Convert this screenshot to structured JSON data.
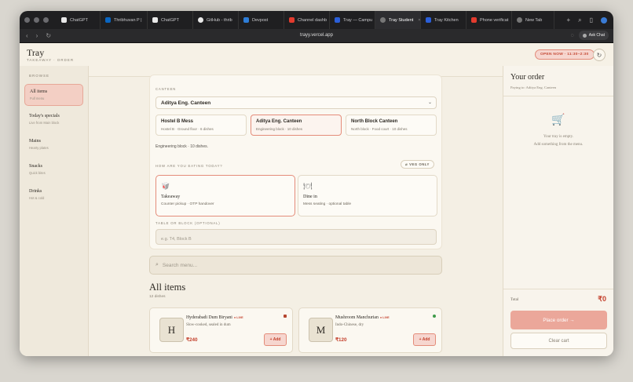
{
  "browser": {
    "tabs": [
      {
        "label": "ChatGPT",
        "favicon_color": "#e9e9e9"
      },
      {
        "label": "Thribhuvan P |",
        "favicon_color": "#0a66c2"
      },
      {
        "label": "ChatGPT",
        "favicon_color": "#e9e9e9"
      },
      {
        "label": "GitHub - thrib",
        "favicon_color": "#e9e9e9"
      },
      {
        "label": "Devpost",
        "favicon_color": "#2e7dd7"
      },
      {
        "label": "Channel dashb",
        "favicon_color": "#e33b2e"
      },
      {
        "label": "Tray — Campu",
        "favicon_color": "#2b5fd9"
      },
      {
        "label": "Tray Student",
        "favicon_color": "#777777"
      },
      {
        "label": "Tray Kitchen",
        "favicon_color": "#2b5fd9"
      },
      {
        "label": "Phone verificat",
        "favicon_color": "#e33b2e"
      },
      {
        "label": "New Tab",
        "favicon_color": "#777777"
      }
    ],
    "new_tab_symbol": "+",
    "url": "trayy.vercel.app",
    "ask_chat_label": "Ask Chat"
  },
  "header": {
    "brand": "Tray",
    "brand_sub": "TAKEAWAY · ORDER",
    "open_badge": "OPEN NOW · 11:30–2:30"
  },
  "sidebar": {
    "heading": "BROWSE",
    "items": [
      {
        "title": "All items",
        "sub": "Full menu"
      },
      {
        "title": "Today's specials",
        "sub": "Live from Main block"
      },
      {
        "title": "Mains",
        "sub": "Hearty plates"
      },
      {
        "title": "Snacks",
        "sub": "Quick bites"
      },
      {
        "title": "Drinks",
        "sub": "Hot & cold"
      }
    ]
  },
  "canteen_card": {
    "label": "CANTEEN",
    "selected": "Aditya Eng. Canteen",
    "options": [
      {
        "name": "Hostel B Mess",
        "sub": "Hostel B · Ground floor · 6 dishes"
      },
      {
        "name": "Aditya Eng. Canteen",
        "sub": "Engineering block · 10 dishes"
      },
      {
        "name": "North Block Canteen",
        "sub": "North block · Food court · 10 dishes"
      }
    ],
    "info": "Engineering block · 10 dishes.",
    "mode_label": "HOW ARE YOU EATING TODAY?",
    "veg_only": "VEG ONLY",
    "modes": [
      {
        "icon": "🥡",
        "title": "Takeaway",
        "sub": "Counter pickup · OTP handover"
      },
      {
        "icon": "🍽",
        "title": "Dine in",
        "sub": "Mess seating · optional table"
      }
    ],
    "table_label": "TABLE OR BLOCK (OPTIONAL)",
    "table_placeholder": "e.g. T4, Block B"
  },
  "menu": {
    "search_placeholder": "Search menu...",
    "title": "All items",
    "count": "12 dishes",
    "dishes": [
      {
        "initial": "H",
        "name": "Hyderabadi Dum Biryani",
        "live": "● LIVE",
        "desc": "Slow-cooked, sealed in dum",
        "price": "₹240",
        "add": "+ Add",
        "type_color": "#b5452f"
      },
      {
        "initial": "M",
        "name": "Mushroom Manchurian",
        "live": "● LIVE",
        "desc": "Indo-Chinese, dry",
        "price": "₹120",
        "add": "+ Add",
        "type_color": "#3f9b4a"
      }
    ]
  },
  "order": {
    "title": "Your order",
    "paying_to": "Paying to: Aditya Eng. Canteen",
    "empty_line1": "Your tray is empty.",
    "empty_line2": "Add something from the menu.",
    "total_label": "Total",
    "total_value": "₹0",
    "place_order": "Place order →",
    "clear_cart": "Clear cart"
  }
}
